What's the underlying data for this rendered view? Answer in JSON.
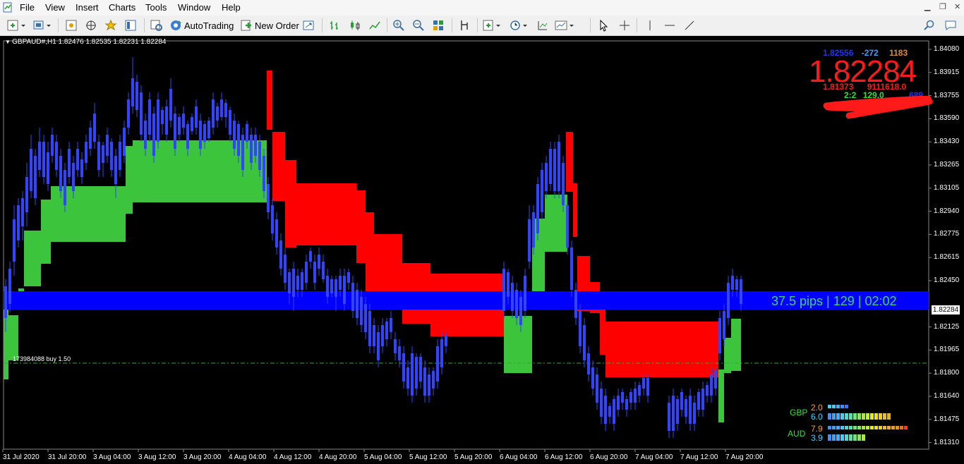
{
  "menu": [
    "File",
    "View",
    "Insert",
    "Charts",
    "Tools",
    "Window",
    "Help"
  ],
  "toolbar": {
    "autotrading_label": "AutoTrading",
    "new_order_label": "New Order"
  },
  "chart": {
    "title": "GBPAUD#,H1  1.82476 1.82535 1.82231 1.82284",
    "price_labels": [
      "1.84080",
      "1.83915",
      "1.83755",
      "1.83590",
      "1.83430",
      "1.83265",
      "1.83105",
      "1.82940",
      "1.82775",
      "1.82615",
      "1.82450",
      "1.82284",
      "1.82125",
      "1.81965",
      "1.81800",
      "1.81640",
      "1.81475",
      "1.81310"
    ],
    "last_price": "1.82284",
    "time_labels": [
      "31 Jul 2020",
      "31 Jul 20:00",
      "3 Aug 04:00",
      "3 Aug 12:00",
      "3 Aug 20:00",
      "4 Aug 04:00",
      "4 Aug 12:00",
      "4 Aug 20:00",
      "5 Aug 04:00",
      "5 Aug 12:00",
      "5 Aug 20:00",
      "6 Aug 04:00",
      "6 Aug 12:00",
      "6 Aug 20:00",
      "7 Aug 04:00",
      "7 Aug 12:00",
      "7 Aug 20:00"
    ],
    "order_label": "173984088 buy 1.50",
    "pip_text": "37.5 pips | 129 | 02:02"
  },
  "info_panel": {
    "row1": {
      "a": "1.82556",
      "b": "-272",
      "c": "1183"
    },
    "big_price": "1.82284",
    "row2": {
      "a": "1.81373",
      "b": "911",
      "c": "1618.0"
    },
    "row3": {
      "a": "2:2",
      "b": "129.0",
      "c": "689"
    }
  },
  "strength": {
    "gbp": {
      "label": "GBP",
      "v1": "2.0",
      "v2": "6.0"
    },
    "aud": {
      "label": "AUD",
      "v1": "7.9",
      "v2": "3.9"
    }
  },
  "colors": {
    "bull": "#3cc43c",
    "bear": "#ff0000",
    "candle": "#3344ff",
    "band": "#0000ff"
  }
}
